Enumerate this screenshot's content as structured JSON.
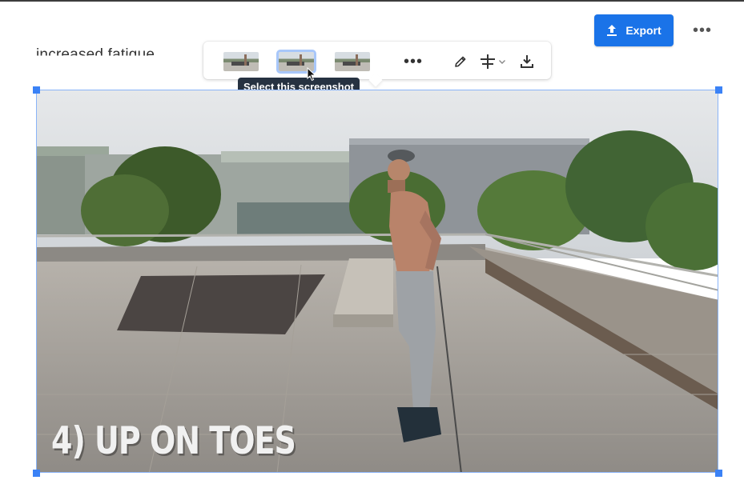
{
  "document": {
    "background_text": "increased fatigue."
  },
  "header": {
    "export_label": "Export",
    "more_label": "•••"
  },
  "toolbar": {
    "more_label": "•••",
    "tooltip": "Select this screenshot",
    "icons": [
      "pencil-icon",
      "crop-lines-icon",
      "chevron-down-icon",
      "download-icon"
    ]
  },
  "video_frame": {
    "caption": "4) UP ON TOES"
  },
  "colors": {
    "accent": "#1a73e8",
    "selection": "#8ab4f8",
    "tooltip_bg": "#263241"
  }
}
